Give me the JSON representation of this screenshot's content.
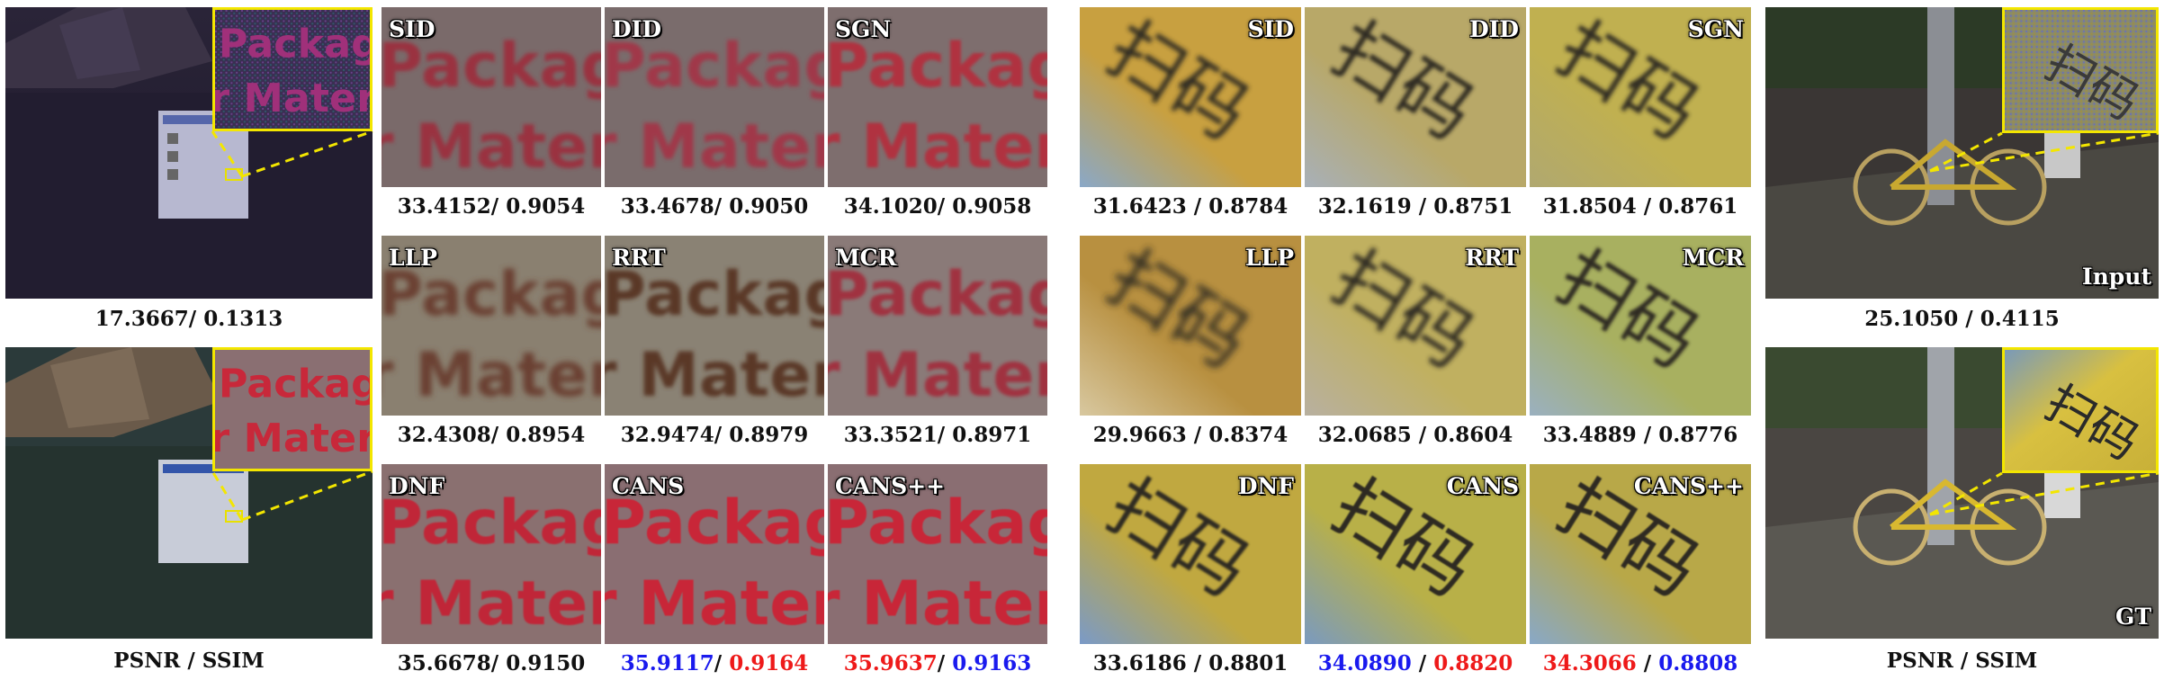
{
  "colors": {
    "best": "#ee1a1a",
    "second": "#1a1aee",
    "zoom_box": "#f3e600"
  },
  "left_input": {
    "caption": "17.3667/ 0.1313"
  },
  "left_gt": {
    "caption": "PSNR / SSIM"
  },
  "left_grid": [
    {
      "label": "SID",
      "psnr": "33.4152",
      "ssim": "0.9054",
      "sep": "/ "
    },
    {
      "label": "DID",
      "psnr": "33.4678",
      "ssim": "0.9050",
      "sep": "/ "
    },
    {
      "label": "SGN",
      "psnr": "34.1020",
      "ssim": "0.9058",
      "sep": "/ "
    },
    {
      "label": "LLP",
      "psnr": "32.4308",
      "ssim": "0.8954",
      "sep": "/ "
    },
    {
      "label": "RRT",
      "psnr": "32.9474",
      "ssim": "0.8979",
      "sep": "/ "
    },
    {
      "label": "MCR",
      "psnr": "33.3521",
      "ssim": "0.8971",
      "sep": "/ "
    },
    {
      "label": "DNF",
      "psnr": "35.6678",
      "ssim": "0.9150",
      "sep": "/ "
    },
    {
      "label": "CANS",
      "psnr": "35.9117",
      "ssim": "0.9164",
      "sep": "/ "
    },
    {
      "label": "CANS++",
      "psnr": "35.9637",
      "ssim": "0.9163",
      "sep": "/ "
    }
  ],
  "right_grid": [
    {
      "label": "SID",
      "psnr": "31.6423",
      "ssim": "0.8784",
      "sep": " / "
    },
    {
      "label": "DID",
      "psnr": "32.1619",
      "ssim": "0.8751",
      "sep": " / "
    },
    {
      "label": "SGN",
      "psnr": "31.8504",
      "ssim": "0.8761",
      "sep": " / "
    },
    {
      "label": "LLP",
      "psnr": "29.9663",
      "ssim": "0.8374",
      "sep": " / "
    },
    {
      "label": "RRT",
      "psnr": "32.0685",
      "ssim": "0.8604",
      "sep": " / "
    },
    {
      "label": "MCR",
      "psnr": "33.4889",
      "ssim": "0.8776",
      "sep": " / "
    },
    {
      "label": "DNF",
      "psnr": "33.6186",
      "ssim": "0.8801",
      "sep": " / "
    },
    {
      "label": "CANS",
      "psnr": "34.0890",
      "ssim": "0.8820",
      "sep": " / "
    },
    {
      "label": "CANS++",
      "psnr": "34.3066",
      "ssim": "0.8808",
      "sep": " / "
    }
  ],
  "right_input": {
    "label": "Input",
    "caption": "25.1050 / 0.4115"
  },
  "right_gt": {
    "label": "GT",
    "caption": "PSNR / SSIM"
  },
  "crop_text": {
    "line1": "Packagi",
    "line2": "r Mater",
    "glyphs": "扫码"
  }
}
